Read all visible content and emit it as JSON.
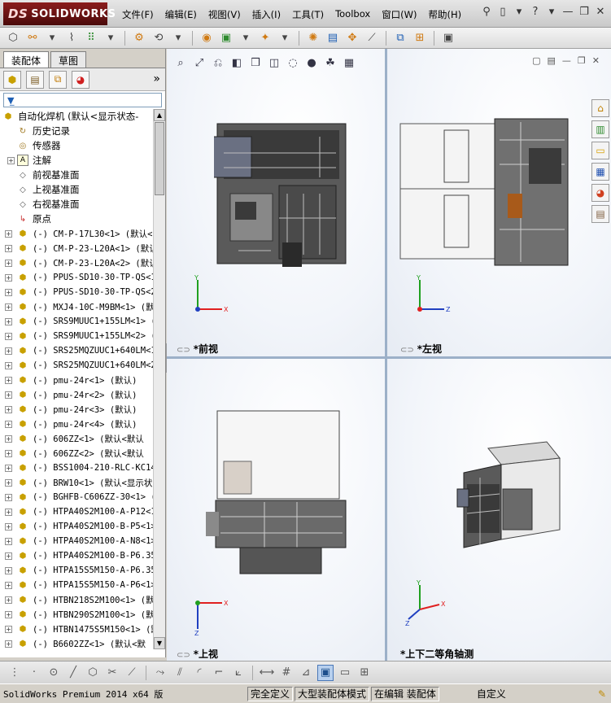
{
  "app": {
    "logo_text": "SOLIDWORKS",
    "logo_prefix": "DS"
  },
  "menu": {
    "items": [
      "文件(F)",
      "编辑(E)",
      "视图(V)",
      "插入(I)",
      "工具(T)",
      "Toolbox",
      "窗口(W)",
      "帮助(H)"
    ]
  },
  "left_panel": {
    "tabs": [
      "装配体",
      "草图"
    ],
    "active_tab": "装配体",
    "filter_icon": "funnel-icon",
    "root_label": "自动化焊机  (默认<显示状态-",
    "fixed_items": [
      {
        "label": "历史记录",
        "icon": "history-icon"
      },
      {
        "label": "传感器",
        "icon": "sensor-icon"
      },
      {
        "label": "注解",
        "icon": "annotation-icon"
      },
      {
        "label": "前视基准面",
        "icon": "plane-icon"
      },
      {
        "label": "上视基准面",
        "icon": "plane-icon"
      },
      {
        "label": "右视基准面",
        "icon": "plane-icon"
      },
      {
        "label": "原点",
        "icon": "origin-icon"
      }
    ],
    "components": [
      "(-) CM-P-17L30<1> (默认<",
      "(-) CM-P-23-L20A<1> (默认",
      "(-) CM-P-23-L20A<2> (默认",
      "(-) PPUS-SD10-30-TP-QS<1",
      "(-) PPUS-SD10-30-TP-QS<2",
      "(-) MXJ4-10C-M9BM<1> (默",
      "(-) SRS9MUUC1+155LM<1> (",
      "(-) SRS9MUUC1+155LM<2> (",
      "(-) SRS25MQZUUC1+640LM<1",
      "(-) SRS25MQZUUC1+640LM<2",
      "(-) pmu-24r<1> (默认)",
      "(-) pmu-24r<2> (默认)",
      "(-) pmu-24r<3> (默认)",
      "(-) pmu-24r<4> (默认)",
      "(-) 606ZZ<1> (默认<默认",
      "(-) 606ZZ<2> (默认<默认",
      "(-) BSS1004-210-RLC-KC14",
      "(-) BRW10<1> (默认<显示状",
      "(-) BGHFB-C606ZZ-30<1> (",
      "(-) HTPA40S2M100-A-P12<1",
      "(-) HTPA40S2M100-B-P5<1>",
      "(-) HTPA40S2M100-A-N8<1>",
      "(-) HTPA40S2M100-B-P6.35",
      "(-) HTPA15S5M150-A-P6.35",
      "(-) HTPA15S5M150-A-P6<1>",
      "(-) HTBN218S2M100<1> (默",
      "(-) HTBN290S2M100<1> (默",
      "(-) HTBN1475S5M150<1> (默",
      "(-) B6602ZZ<1> (默认<默"
    ]
  },
  "viewports": {
    "front_label": "*前视",
    "left_label": "*左视",
    "top_label": "*上视",
    "iso_label": "*上下二等角轴测"
  },
  "status_bar": {
    "product": "SolidWorks Premium 2014 x64 版",
    "cells": [
      "完全定义",
      "大型装配体模式",
      "在编辑 装配体"
    ],
    "units": "自定义"
  },
  "colors": {
    "logo_bg": "#6b1414",
    "viewport_divider": "#9cb0c8",
    "axis_x": "#e02020",
    "axis_y": "#20a020",
    "axis_z": "#2040c0"
  }
}
